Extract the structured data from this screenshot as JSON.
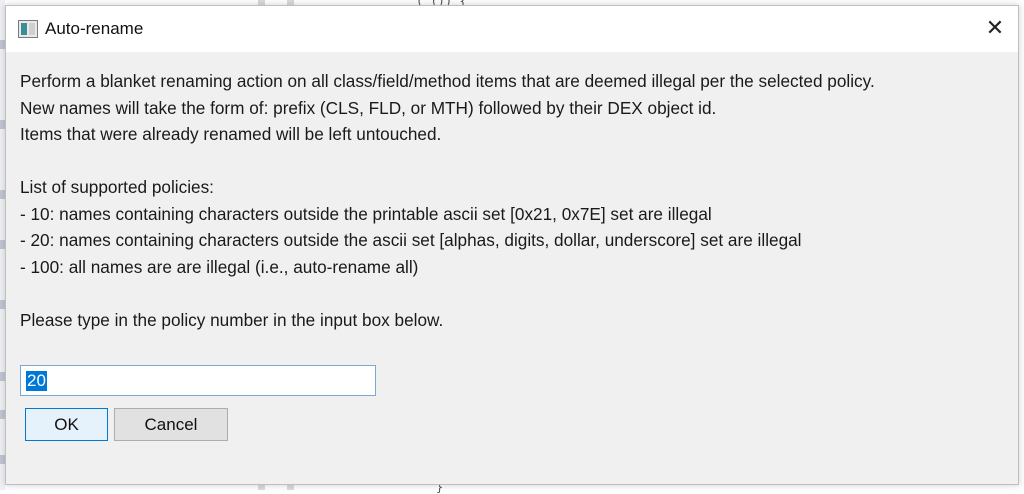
{
  "dialog": {
    "title": "Auto-rename",
    "close_symbol": "✕",
    "icon": "app-window-icon"
  },
  "message": {
    "lines": [
      "Perform a blanket renaming action on all class/field/method items that are deemed illegal per the selected policy.",
      "New names will take the form of: prefix (CLS, FLD, or MTH) followed by their DEX object id.",
      "Items that were already renamed will be left untouched.",
      "",
      "List of supported policies:",
      "- 10: names containing characters outside the printable ascii set [0x21, 0x7E] set are illegal",
      "- 20: names containing characters outside the ascii set [alphas, digits, dollar, underscore] set are illegal",
      "- 100: all names are are illegal (i.e., auto-rename all)",
      "",
      "Please type in the policy number in the input box below."
    ]
  },
  "input": {
    "value": "20"
  },
  "buttons": {
    "ok": "OK",
    "cancel": "Cancel"
  },
  "background": {
    "code_top": "(  ()) {",
    "code_bottom": "}"
  },
  "colors": {
    "dialog_bg": "#f0f0f0",
    "titlebar_bg": "#ffffff",
    "selection": "#0078d7",
    "focus_border": "#0078d7"
  }
}
